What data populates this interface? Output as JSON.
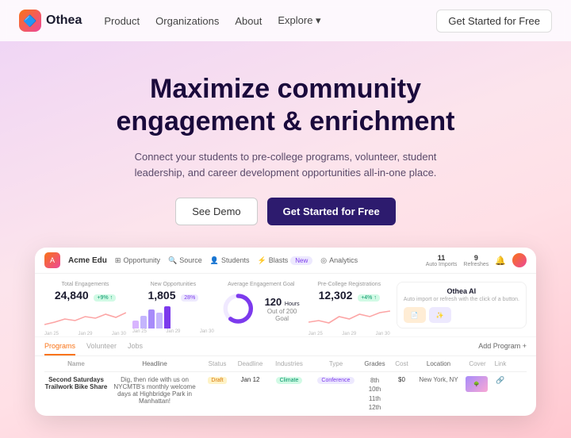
{
  "nav": {
    "logo_text": "Othea",
    "logo_emoji": "🔷",
    "links": [
      "Product",
      "Organizations",
      "About",
      "Explore ▾"
    ],
    "cta": "Get Started for Free"
  },
  "hero": {
    "title_line1": "Maximize community",
    "title_line2": "engagement & enrichment",
    "subtitle": "Connect your students to pre-college programs, volunteer, student leadership, and career development opportunities all-in-one place.",
    "btn_demo": "See Demo",
    "btn_cta": "Get Started for Free"
  },
  "dashboard": {
    "company": "Acme Edu",
    "nav_items": [
      "Opportunity",
      "Source",
      "Students",
      "Blasts",
      "Analytics"
    ],
    "auto_import_count": "11",
    "auto_import_label": "Auto Imports",
    "refreshes_count": "9",
    "refreshes_label": "Refreshes",
    "stats": [
      {
        "label": "Total Engagements",
        "value": "24,840",
        "change": "+9% ↑",
        "change_color": "green",
        "chart_type": "line"
      },
      {
        "label": "New Opportunities",
        "value": "1,805",
        "badge": "28%",
        "badge_color": "purple",
        "chart_type": "bar"
      },
      {
        "label": "Average Engagement Goal",
        "value": "120",
        "unit": "Hours",
        "goal": "Out of 200 Goal",
        "chart_type": "donut"
      },
      {
        "label": "Pre-College Registrations",
        "value": "12,302",
        "change": "+4% ↑",
        "change_color": "green",
        "chart_type": "line"
      }
    ],
    "ai_panel": {
      "title": "Othea AI",
      "subtitle": "Auto import or refresh with the click of a button.",
      "btn1": "📄",
      "btn2": "✨"
    },
    "tabs": [
      "Programs",
      "Volunteer",
      "Jobs"
    ],
    "active_tab": "Programs",
    "add_program": "Add Program +",
    "table_headers": [
      "Name",
      "Headline",
      "Status",
      "Deadline",
      "Industries",
      "Type",
      "Grades",
      "Cost",
      "Location",
      "Cover",
      "Link"
    ],
    "table_rows": [
      {
        "name": "Second Saturdays Trailwork Bike Share",
        "headline": "Dig, then ride with us on NYCMTB's monthly welcome days at Highbridge Park in Manhattan!",
        "status": "Draft",
        "deadline": "Jan 12",
        "industry": "Climate",
        "type": "Conference",
        "grades": "8th\n10th\n11th\n12th",
        "cost": "$0",
        "location": "New York, NY",
        "has_cover": true,
        "has_link": true
      }
    ],
    "chart_dates": [
      "Jan 25",
      "Jan 29",
      "Jan 30"
    ]
  }
}
